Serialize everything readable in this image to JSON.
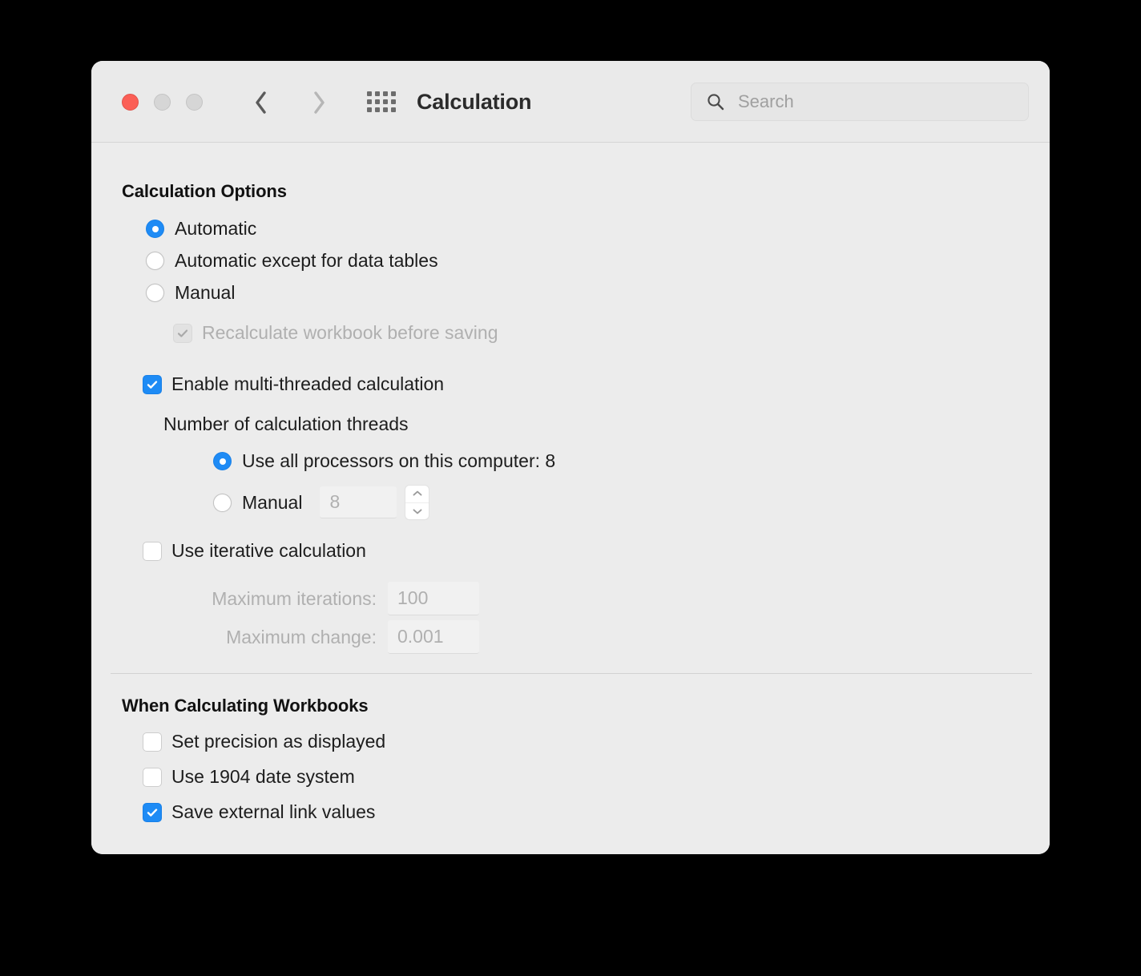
{
  "window": {
    "title": "Calculation",
    "traffic_lights": [
      {
        "name": "close",
        "color": "#fb5f56"
      },
      {
        "name": "minimize",
        "color": "#d6d6d6"
      },
      {
        "name": "maximize",
        "color": "#d6d6d6"
      }
    ],
    "nav": {
      "back_icon": "chevron-left-icon",
      "forward_icon": "chevron-right-icon"
    },
    "grid_icon": "show-all-preferences-grid-icon"
  },
  "search": {
    "icon": "search-icon",
    "placeholder": "Search",
    "value": ""
  },
  "calculation_options": {
    "heading": "Calculation Options",
    "mode_radios": [
      {
        "label": "Automatic",
        "selected": true
      },
      {
        "label": "Automatic except for data tables",
        "selected": false
      },
      {
        "label": "Manual",
        "selected": false
      }
    ],
    "recalculate_before_saving": {
      "label": "Recalculate workbook before saving",
      "checked": true,
      "enabled": false
    },
    "multithread": {
      "label": "Enable multi-threaded calculation",
      "checked": true,
      "enabled": true
    },
    "threads_heading": "Number of calculation threads",
    "thread_radios": [
      {
        "label": "Use all processors on this computer: 8",
        "selected": true
      },
      {
        "label": "Manual",
        "selected": false
      }
    ],
    "threads_field": {
      "value": "8",
      "enabled": false
    },
    "stepper": {
      "up_icon": "chevron-up-icon",
      "down_icon": "chevron-down-icon"
    },
    "iterative": {
      "label": "Use iterative calculation",
      "checked": false,
      "enabled": true
    },
    "max_iterations": {
      "label": "Maximum iterations:",
      "value": "100",
      "enabled": false
    },
    "max_change": {
      "label": "Maximum change:",
      "value": "0.001",
      "enabled": false
    }
  },
  "when_calculating_workbooks": {
    "heading": "When Calculating Workbooks",
    "checkboxes": [
      {
        "label": "Set precision as displayed",
        "checked": false
      },
      {
        "label": "Use 1904 date system",
        "checked": false
      },
      {
        "label": "Save external link values",
        "checked": true
      }
    ]
  },
  "colors": {
    "accent_blue": "#1e8bf5",
    "window_background": "#ececec",
    "toolbar_background": "#eaeaea",
    "page_background": "#000000",
    "disabled_text": "#b0b0b0"
  }
}
